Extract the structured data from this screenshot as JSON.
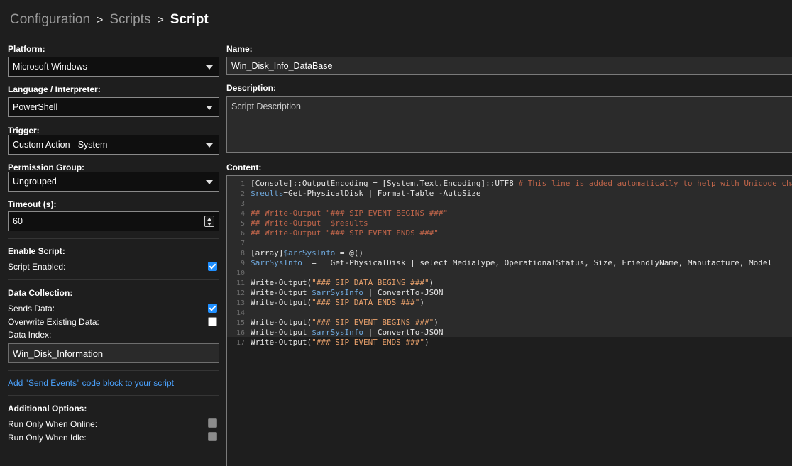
{
  "breadcrumb": {
    "items": [
      "Configuration",
      "Scripts"
    ],
    "separator": ">",
    "current": "Script"
  },
  "left": {
    "platform": {
      "label": "Platform:",
      "value": "Microsoft Windows"
    },
    "language": {
      "label": "Language / Interpreter:",
      "value": "PowerShell"
    },
    "trigger": {
      "label": "Trigger:",
      "value": "Custom Action - System"
    },
    "permission": {
      "label": "Permission Group:",
      "value": "Ungrouped"
    },
    "timeout": {
      "label": "Timeout (s):",
      "value": "60"
    },
    "enable": {
      "title": "Enable Script:",
      "script_enabled_label": "Script Enabled:",
      "script_enabled": true
    },
    "data_collection": {
      "title": "Data Collection:",
      "sends_data_label": "Sends Data:",
      "sends_data": true,
      "overwrite_label": "Overwrite Existing Data:",
      "overwrite": false,
      "data_index_label": "Data Index:",
      "data_index": "Win_Disk_Information"
    },
    "send_events_link": "Add \"Send Events\" code block to your script",
    "additional": {
      "title": "Additional Options:",
      "run_online_label": "Run Only When Online:",
      "run_online": false,
      "run_idle_label": "Run Only When Idle:",
      "run_idle": false
    }
  },
  "right": {
    "name_label": "Name:",
    "name_value": "Win_Disk_Info_DataBase",
    "description_label": "Description:",
    "description_placeholder": "Script Description",
    "content_label": "Content:",
    "code_lines": [
      [
        [
          "plain",
          "[Console]::OutputEncoding = [System.Text.Encoding]::UTF8 "
        ],
        [
          "com",
          "# This line is added automatically to help with Unicode characters"
        ]
      ],
      [
        [
          "var",
          "$reults"
        ],
        [
          "plain",
          "=Get-PhysicalDisk | Format-Table -AutoSize"
        ]
      ],
      [],
      [
        [
          "com",
          "## Write-Output \"### SIP EVENT BEGINS ###\""
        ]
      ],
      [
        [
          "com",
          "## Write-Output  $results"
        ]
      ],
      [
        [
          "com",
          "## Write-Output \"### SIP EVENT ENDS ###\""
        ]
      ],
      [],
      [
        [
          "plain",
          "[array]"
        ],
        [
          "var",
          "$arrSysInfo"
        ],
        [
          "plain",
          " = @()"
        ]
      ],
      [
        [
          "var",
          "$arrSysInfo"
        ],
        [
          "plain",
          "  =   Get-PhysicalDisk | select MediaType, OperationalStatus, Size, FriendlyName, Manufacture, Model"
        ]
      ],
      [],
      [
        [
          "plain",
          "Write-Output("
        ],
        [
          "str",
          "\"### SIP DATA BEGINS ###\""
        ],
        [
          "plain",
          ")"
        ]
      ],
      [
        [
          "plain",
          "Write-Output "
        ],
        [
          "var",
          "$arrSysInfo"
        ],
        [
          "plain",
          " | ConvertTo-JSON"
        ]
      ],
      [
        [
          "plain",
          "Write-Output("
        ],
        [
          "str",
          "\"### SIP DATA ENDS ###\""
        ],
        [
          "plain",
          ")"
        ]
      ],
      [],
      [
        [
          "plain",
          "Write-Output("
        ],
        [
          "str",
          "\"### SIP EVENT BEGINS ###\""
        ],
        [
          "plain",
          ")"
        ]
      ],
      [
        [
          "plain",
          "Write-Output "
        ],
        [
          "var",
          "$arrSysInfo"
        ],
        [
          "plain",
          " | ConvertTo-JSON"
        ]
      ],
      [
        [
          "plain",
          "Write-Output("
        ],
        [
          "str",
          "\"### SIP EVENT ENDS ###\""
        ],
        [
          "plain",
          ")"
        ]
      ]
    ]
  },
  "colors": {
    "accent": "#1f8fff",
    "link": "#4ba3ff",
    "comment": "#c0654a",
    "variable": "#6fa8dc",
    "string": "#e8a06b"
  }
}
